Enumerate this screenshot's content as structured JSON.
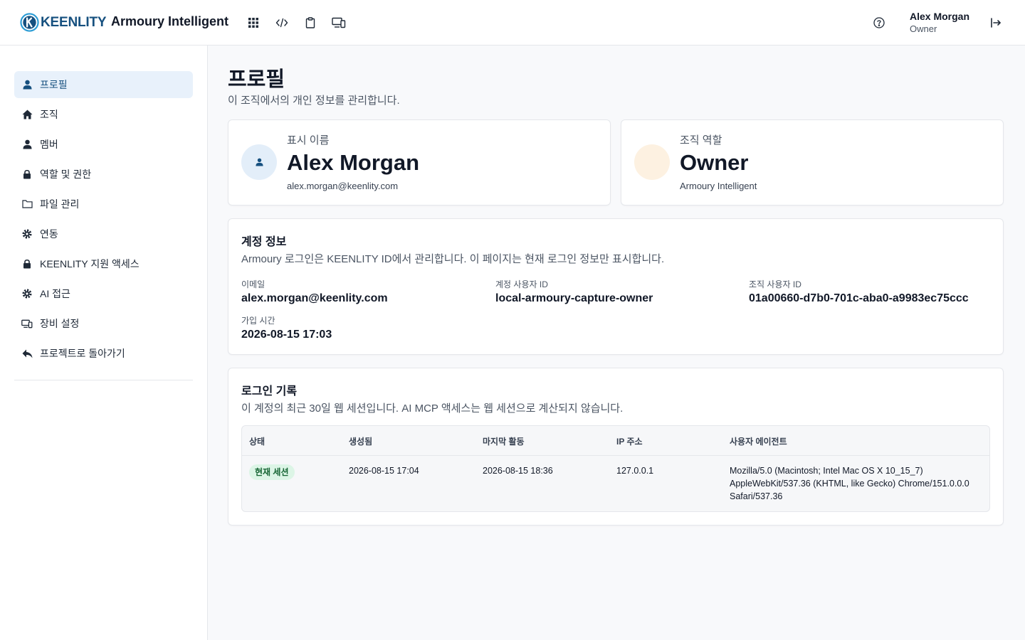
{
  "header": {
    "logo_text": "KEENLITY",
    "org_name": "Armoury Intelligent",
    "icons": [
      "apps-grid-icon",
      "code-icon",
      "clipboard-icon",
      "devices-icon"
    ],
    "help_icon": "help-circle-icon",
    "logout_icon": "logout-icon",
    "user": {
      "name": "Alex Morgan",
      "role": "Owner"
    }
  },
  "sidebar": {
    "items": [
      {
        "label": "프로필",
        "icon": "person-icon",
        "active": true
      },
      {
        "label": "조직",
        "icon": "home-icon",
        "active": false
      },
      {
        "label": "멤버",
        "icon": "person-icon",
        "active": false
      },
      {
        "label": "역할 및 권한",
        "icon": "lock-icon",
        "active": false
      },
      {
        "label": "파일 관리",
        "icon": "folder-icon",
        "active": false
      },
      {
        "label": "연동",
        "icon": "gear-icon",
        "active": false
      },
      {
        "label": "KEENLITY 지원 액세스",
        "icon": "lock-icon",
        "active": false
      },
      {
        "label": "AI 접근",
        "icon": "gear-icon",
        "active": false
      },
      {
        "label": "장비 설정",
        "icon": "devices-icon",
        "active": false
      },
      {
        "label": "프로젝트로 돌아가기",
        "icon": "reply-icon",
        "active": false
      }
    ]
  },
  "page": {
    "title": "프로필",
    "description": "이 조직에서의 개인 정보를 관리합니다."
  },
  "profile_card": {
    "label": "표시 이름",
    "name": "Alex Morgan",
    "email": "alex.morgan@keenlity.com"
  },
  "role_card": {
    "label": "조직 역할",
    "role": "Owner",
    "org": "Armoury Intelligent"
  },
  "account": {
    "title": "계정 정보",
    "description": "Armoury 로그인은 KEENLITY ID에서 관리합니다. 이 페이지는 현재 로그인 정보만 표시합니다.",
    "fields": {
      "email": {
        "label": "이메일",
        "value": "alex.morgan@keenlity.com"
      },
      "account_user_id": {
        "label": "계정 사용자 ID",
        "value": "local-armoury-capture-owner"
      },
      "org_user_id": {
        "label": "조직 사용자 ID",
        "value": "01a00660-d7b0-701c-aba0-a9983ec75ccc"
      },
      "joined": {
        "label": "가입 시간",
        "value": "2026-08-15 17:03"
      }
    }
  },
  "login_history": {
    "title": "로그인 기록",
    "description": "이 계정의 최근 30일 웹 세션입니다. AI MCP 액세스는 웹 세션으로 계산되지 않습니다.",
    "columns": [
      "상태",
      "생성됨",
      "마지막 활동",
      "IP 주소",
      "사용자 에이전트"
    ],
    "rows": [
      {
        "status": "현재 세션",
        "created": "2026-08-15 17:04",
        "last_active": "2026-08-15 18:36",
        "ip": "127.0.0.1",
        "user_agent": "Mozilla/5.0 (Macintosh; Intel Mac OS X 10_15_7) AppleWebKit/537.36 (KHTML, like Gecko) Chrome/151.0.0.0 Safari/537.36"
      }
    ]
  },
  "colors": {
    "brand": "#16507f",
    "active_bg": "#e8f1fb",
    "badge_bg": "#dcf5e6",
    "badge_text": "#166534",
    "avatar_bg": "#e3eef9",
    "role_avatar_bg": "#fdf1e1"
  }
}
